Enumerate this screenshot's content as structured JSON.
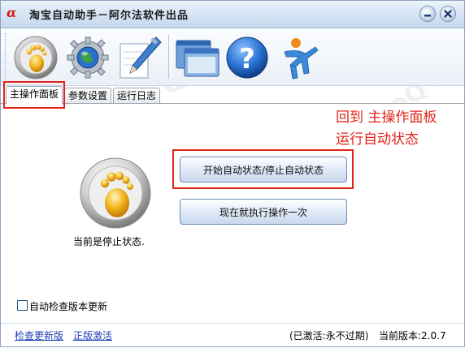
{
  "window": {
    "title": "淘宝自动助手－阿尔法软件出品",
    "logo_text": "α"
  },
  "toolbar": {
    "icons": [
      "start-stop-icon",
      "settings-gear-icon",
      "edit-pen-icon",
      "windows-icon",
      "help-icon",
      "about-runner-icon"
    ]
  },
  "tabs": [
    {
      "label": "主操作面板",
      "active": true
    },
    {
      "label": "参数设置",
      "active": false
    },
    {
      "label": "运行日志",
      "active": false
    }
  ],
  "main": {
    "toggle_button": "开始自动状态/停止自动状态",
    "run_once_button": "现在就执行操作一次",
    "status_text": "当前是停止状态.",
    "auto_update_checkbox": {
      "label": "自动检查版本更新",
      "checked": false
    }
  },
  "annotation": {
    "line1": "回到 主操作面板",
    "line2": "运行自动状态",
    "color": "#e2231a"
  },
  "footer": {
    "check_update_link": "检查更新版",
    "activate_link": "正版激活",
    "activation_status": "(已激活:永不过期)",
    "version_text": "当前版本:2.0.7"
  },
  "watermark": "QQTN.COM"
}
